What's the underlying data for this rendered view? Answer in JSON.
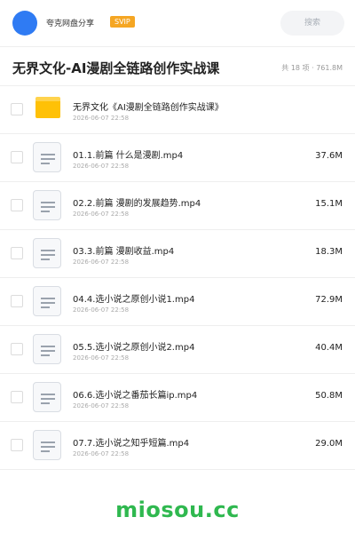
{
  "header": {
    "user_name": "夸克网盘分享",
    "badge": "SVIP",
    "search_placeholder": "搜索",
    "colors": {
      "avatar": "#2f7bf3",
      "badge": "#f5a623"
    }
  },
  "folder": {
    "title": "无界文化-AI漫剧全链路创作实战课",
    "meta": "共 18 项 · 761.8M"
  },
  "files": [
    {
      "name": "无界文化《AI漫剧全链路创作实战课》",
      "date": "2026-06-07 22:58",
      "size": "",
      "type": "folder",
      "icon": "folder-icon"
    },
    {
      "name": "01.1.前篇 什么是漫剧.mp4",
      "date": "2026-06-07 22:58",
      "size": "37.6M",
      "type": "video",
      "icon": "file-icon"
    },
    {
      "name": "02.2.前篇 漫剧的发展趋势.mp4",
      "date": "2026-06-07 22:58",
      "size": "15.1M",
      "type": "video",
      "icon": "file-icon"
    },
    {
      "name": "03.3.前篇 漫剧收益.mp4",
      "date": "2026-06-07 22:58",
      "size": "18.3M",
      "type": "video",
      "icon": "file-icon"
    },
    {
      "name": "04.4.选小说之原创小说1.mp4",
      "date": "2026-06-07 22:58",
      "size": "72.9M",
      "type": "video",
      "icon": "file-icon"
    },
    {
      "name": "05.5.选小说之原创小说2.mp4",
      "date": "2026-06-07 22:58",
      "size": "40.4M",
      "type": "video",
      "icon": "file-icon"
    },
    {
      "name": "06.6.选小说之番茄长篇ip.mp4",
      "date": "2026-06-07 22:58",
      "size": "50.8M",
      "type": "video",
      "icon": "file-icon"
    },
    {
      "name": "07.7.选小说之知乎短篇.mp4",
      "date": "2026-06-07 22:58",
      "size": "29.0M",
      "type": "video",
      "icon": "file-icon"
    }
  ],
  "watermark": "miosou.cc",
  "colors": {
    "watermark": "#2fb84f",
    "folder": "#ffc107"
  }
}
